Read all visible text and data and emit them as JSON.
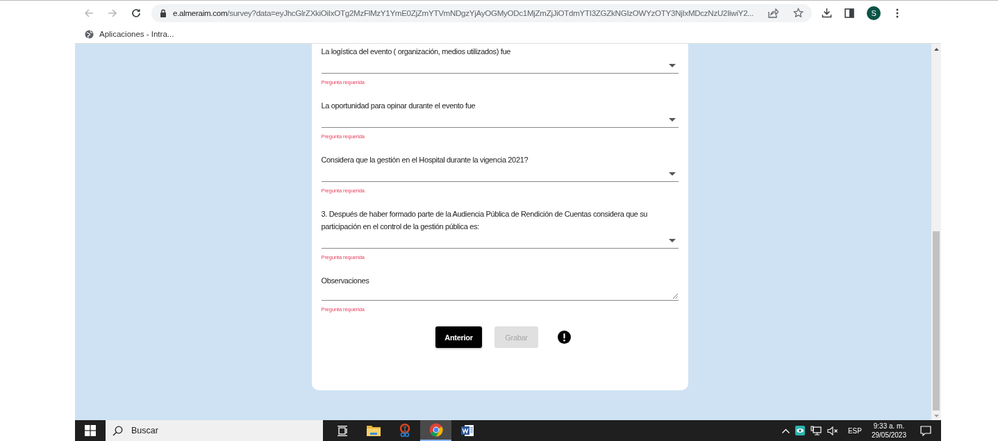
{
  "browser": {
    "url_host": "e.almeraim.com",
    "url_path": "/survey?data=eyJhcGlrZXkiOiIxOTg2MzFlMzY1YmE0ZjZmYTVmNDgzYjAyOGMyODc1MjZmZjJiOTdmYTI3ZGZkNGIzOWYzOTY3NjIxMDczNzU2IiwiY2...",
    "back_disabled": true,
    "forward_disabled": true,
    "avatar": "S"
  },
  "bookmarks": [
    {
      "label": "Aplicaciones - Intra..."
    }
  ],
  "questions": [
    {
      "kind": "select",
      "label": "La logística del evento ( organización, medios utilizados) fue",
      "error": "Pregunta requerida"
    },
    {
      "kind": "select",
      "label": "La oportunidad para opinar durante el evento fue",
      "error": "Pregunta requerida"
    },
    {
      "kind": "select",
      "label": "Considera que la gestión en el Hospital durante la vigencia 2021?",
      "error": "Pregunta requerida"
    },
    {
      "kind": "select",
      "label": "3. Después de haber formado parte de la Audiencia Pública de Rendición de Cuentas considera que su participación en el control de la gestión pública es:",
      "error": "Pregunta requerida"
    },
    {
      "kind": "textarea",
      "label": "Observaciones",
      "error": "Pregunta requerida"
    }
  ],
  "buttons": [
    {
      "label": "Anterior",
      "disabled": false
    },
    {
      "label": "Grabar",
      "disabled": true
    }
  ],
  "taskbar": {
    "search_placeholder": "Buscar",
    "apps": [
      {
        "kind": "taskview",
        "selected": false
      },
      {
        "kind": "folder",
        "selected": false
      },
      {
        "kind": "snip",
        "selected": false
      },
      {
        "kind": "browser",
        "selected": true
      },
      {
        "kind": "document",
        "selected": false
      }
    ],
    "language": "ESP",
    "time": "9:33 a. m.",
    "date": "29/05/2023"
  }
}
